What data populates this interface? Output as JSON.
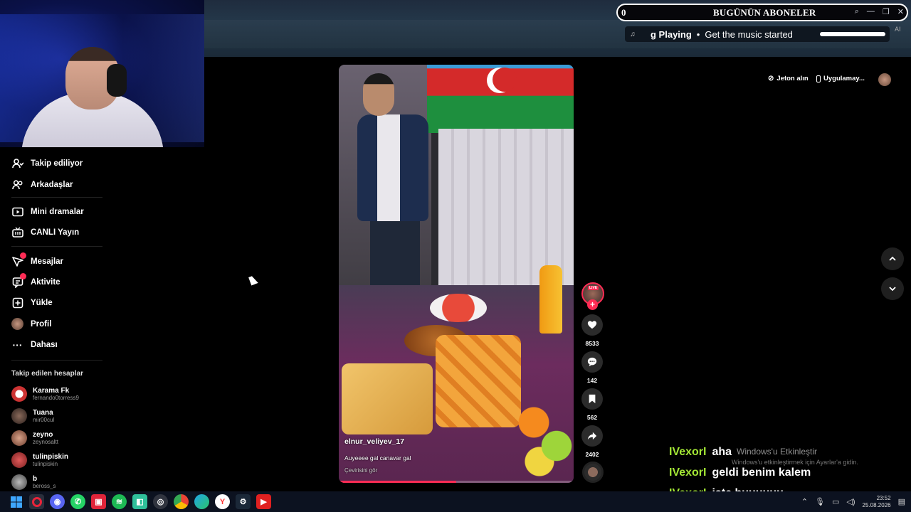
{
  "overlay": {
    "subscribers_count": "0",
    "subscribers_title": "BUGÜNÜN ABONELER",
    "music_title": "g Playing",
    "music_subtitle": "Get the music started",
    "ai_label": "AI"
  },
  "sidebar": {
    "items": [
      {
        "label": "Takip ediliyor",
        "icon": "following-icon"
      },
      {
        "label": "Arkadaşlar",
        "icon": "friends-icon"
      },
      {
        "label": "Mini dramalar",
        "icon": "mini-drama-icon"
      },
      {
        "label": "CANLI Yayın",
        "icon": "live-icon"
      },
      {
        "label": "Mesajlar",
        "icon": "messages-icon",
        "badge": true
      },
      {
        "label": "Aktivite",
        "icon": "activity-icon",
        "badge": true
      },
      {
        "label": "Yükle",
        "icon": "upload-icon"
      },
      {
        "label": "Profil",
        "icon": "profile-icon"
      },
      {
        "label": "Dahası",
        "icon": "more-icon"
      }
    ],
    "followed_title": "Takip edilen hesaplar",
    "accounts": [
      {
        "name": "Karama Fk",
        "handle": "fernando0torress9"
      },
      {
        "name": "Tuana",
        "handle": "mir00cul"
      },
      {
        "name": "zeyno",
        "handle": "zeynosaltt"
      },
      {
        "name": "tulinpiskin",
        "handle": "tulinpiskin"
      },
      {
        "name": "b",
        "handle": "beross_s"
      }
    ]
  },
  "header": {
    "coins_label": "Jeton alın",
    "app_label": "Uygulamay..."
  },
  "video": {
    "username": "elnur_veliyev_17",
    "caption": "Auyeeee gal canavar gal",
    "translate_label": "Çevirisini gör",
    "progress_fraction": 0.5
  },
  "actions": {
    "live_tag": "LIVE",
    "likes": "8533",
    "comments": "142",
    "saves": "562",
    "shares": "2402"
  },
  "chat": [
    {
      "user": "IVexorI",
      "message": "aha"
    },
    {
      "user": "IVexorI",
      "message": "geldi benim kalem"
    },
    {
      "user": "IVexorI",
      "message": "işte buuuuuu"
    }
  ],
  "windows_notice": {
    "title": "Windows'u Etkinleştir",
    "subtitle": "Windows'u etkinleştirmek için Ayarlar'a gidin."
  },
  "taskbar": {
    "time": "23:52",
    "date": "25.08.2026"
  }
}
